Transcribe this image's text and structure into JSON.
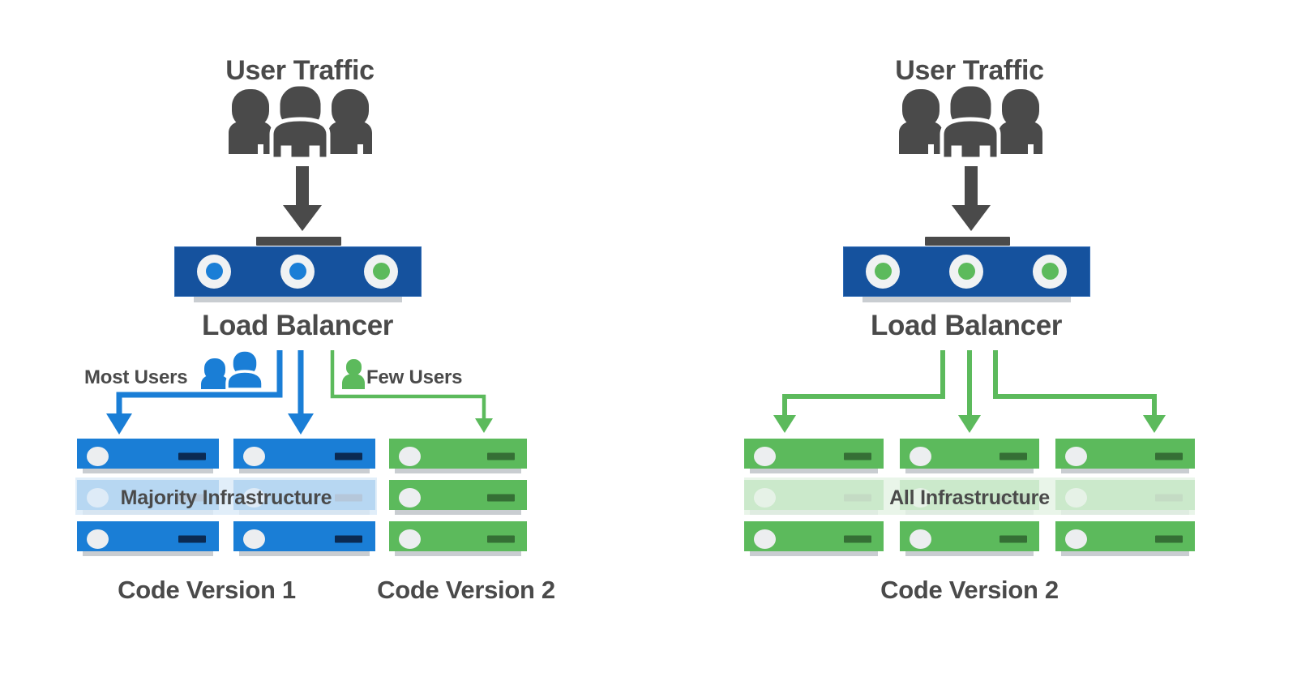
{
  "meta": {
    "title": "Canary Deployment vs Full Rollout",
    "colors": {
      "text": "#4a4a4a",
      "blue_dark": "#15529e",
      "blue": "#1a7ed6",
      "blue_deep": "#0b2a52",
      "green": "#5cba5c",
      "green_dark": "#356f35",
      "gray_icon": "#4a4a4a",
      "shadow": "#c9cdd1",
      "band_blue": "#dbeaf8",
      "band_green": "#e4f3e4",
      "background": "#ffffff"
    }
  },
  "panels": [
    {
      "id": "canary",
      "traffic_title": "User Traffic",
      "traffic_icon": "three-people-icon",
      "traffic_arrow_icon": "down-arrow-icon",
      "load_balancer": {
        "label": "Load Balancer",
        "icon": "load-balancer-icon",
        "leds": [
          "blue",
          "blue",
          "green"
        ]
      },
      "flows": [
        {
          "label": "Most Users",
          "icon": "two-people-icon",
          "color": "blue"
        },
        {
          "label": "",
          "icon": "",
          "color": "blue"
        },
        {
          "label": "Few Users",
          "icon": "one-person-icon",
          "color": "green"
        }
      ],
      "infrastructure_band": {
        "label": "Majority Infrastructure",
        "color": "band_blue"
      },
      "racks": [
        {
          "color": "blue",
          "units": 3
        },
        {
          "color": "blue",
          "units": 3
        },
        {
          "color": "green",
          "units": 3
        }
      ],
      "version_labels": [
        {
          "text": "Code Version 1",
          "span": "racks-1-2"
        },
        {
          "text": "Code Version 2",
          "span": "rack-3"
        }
      ]
    },
    {
      "id": "full-rollout",
      "traffic_title": "User Traffic",
      "traffic_icon": "three-people-icon",
      "traffic_arrow_icon": "down-arrow-icon",
      "load_balancer": {
        "label": "Load Balancer",
        "icon": "load-balancer-icon",
        "leds": [
          "green",
          "green",
          "green"
        ]
      },
      "flows": [
        {
          "label": "",
          "icon": "",
          "color": "green"
        },
        {
          "label": "",
          "icon": "",
          "color": "green"
        },
        {
          "label": "",
          "icon": "",
          "color": "green"
        }
      ],
      "infrastructure_band": {
        "label": "All Infrastructure",
        "color": "band_green"
      },
      "racks": [
        {
          "color": "green",
          "units": 3
        },
        {
          "color": "green",
          "units": 3
        },
        {
          "color": "green",
          "units": 3
        }
      ],
      "version_labels": [
        {
          "text": "Code Version 2",
          "span": "racks-1-2-3"
        }
      ]
    }
  ]
}
